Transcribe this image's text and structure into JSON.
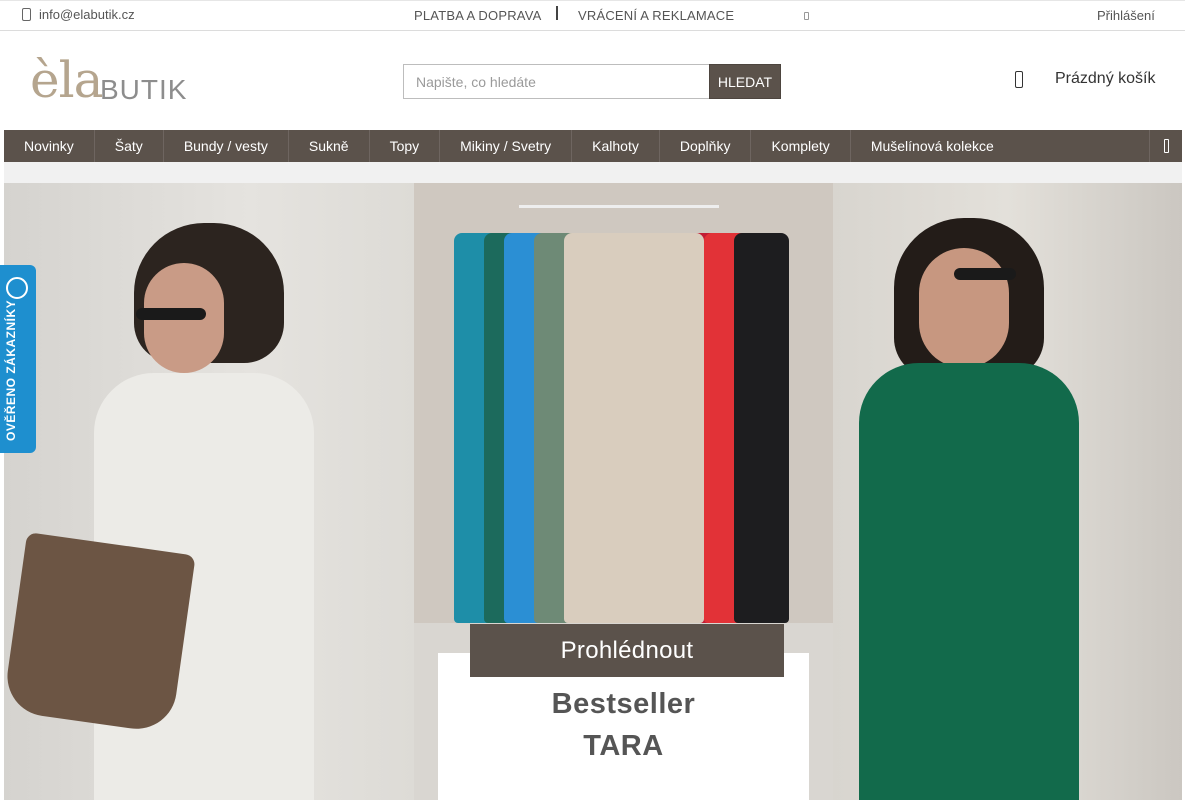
{
  "topbar": {
    "email": "info@elabutik.cz",
    "links": [
      "PLATBA A DOPRAVA",
      "VRÁCENÍ A REKLAMACE"
    ],
    "login": "Přihlášení"
  },
  "logo": {
    "ela": "èla",
    "butik": "BUTIK"
  },
  "search": {
    "placeholder": "Napište, co hledáte",
    "button": "HLEDAT"
  },
  "cart": {
    "label": "Prázdný košík"
  },
  "nav": {
    "items": [
      "Novinky",
      "Šaty",
      "Bundy / vesty",
      "Sukně",
      "Topy",
      "Mikiny / Svetry",
      "Kalhoty",
      "Doplňky",
      "Komplety",
      "Mušelínová kolekce"
    ]
  },
  "banner": {
    "button": "Prohlédnout",
    "line1": "Bestseller",
    "line2": "TARA"
  },
  "badge": {
    "text": "OVĚŘENO ZÁKAZNÍKY"
  }
}
